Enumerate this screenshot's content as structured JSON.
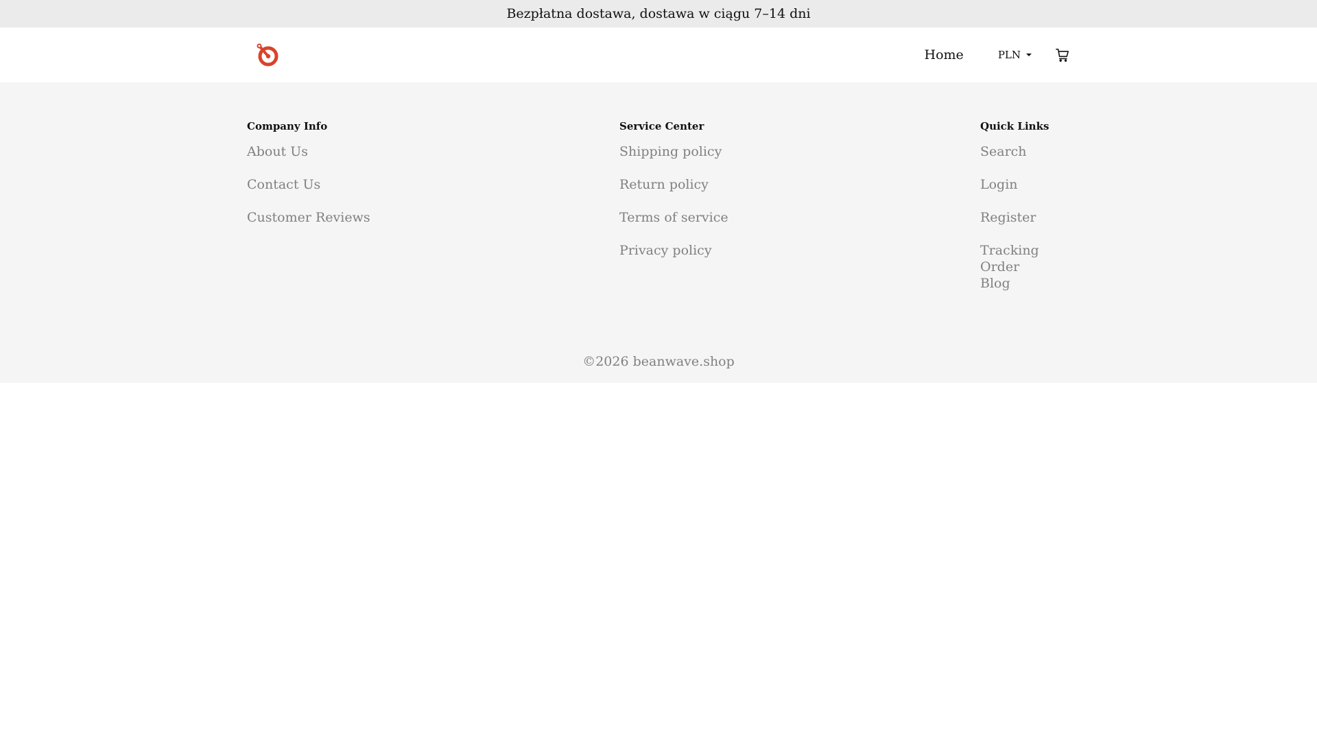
{
  "announcement": {
    "text": "Bezpłatna dostawa, dostawa w ciągu 7–14 dni"
  },
  "header": {
    "logo_icon": "brand-logo-icon",
    "brand_color": "#d9432b",
    "nav": {
      "home_label": "Home"
    },
    "currency": {
      "selected": "PLN"
    },
    "cart_icon": "cart-icon"
  },
  "footer": {
    "columns": [
      {
        "title": "Company Info",
        "links": [
          "About Us",
          "Contact Us",
          "Customer Reviews"
        ]
      },
      {
        "title": "Service Center",
        "links": [
          "Shipping policy",
          "Return policy",
          "Terms of service",
          "Privacy policy"
        ]
      },
      {
        "title": "Quick Links",
        "links": [
          "Search",
          "Login",
          "Register",
          "Tracking Order",
          "Blog"
        ]
      }
    ],
    "copyright": "©2026 beanwave.shop"
  }
}
